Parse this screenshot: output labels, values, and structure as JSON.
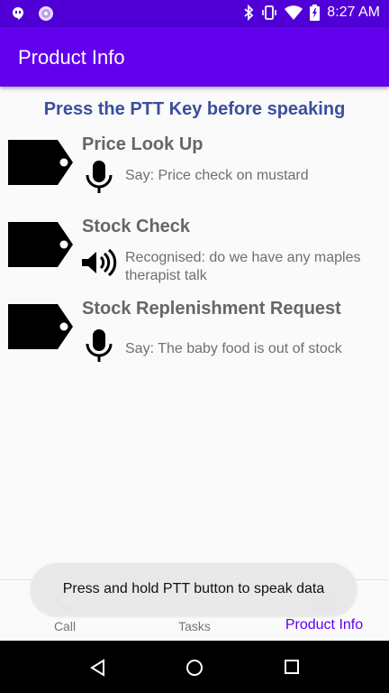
{
  "status_bar": {
    "time": "8:27 AM",
    "icons": [
      "hangouts-icon",
      "app-notification-icon",
      "bluetooth-icon",
      "vibrate-icon",
      "wifi-icon",
      "battery-charging-icon"
    ]
  },
  "app_bar": {
    "title": "Product Info"
  },
  "instruction": "Press the PTT Key before speaking",
  "items": [
    {
      "title": "Price Look Up",
      "icon": "microphone-icon",
      "detail": "Say: Price check on mustard"
    },
    {
      "title": "Stock Check",
      "icon": "speaker-icon",
      "detail": "Recognised: do we have any maples therapist talk"
    },
    {
      "title": "Stock Replenishment Request",
      "icon": "microphone-icon",
      "detail": "Say: The baby food is out of stock"
    }
  ],
  "bottom_nav": [
    {
      "label": "Call",
      "icon": "phone-icon",
      "active": false
    },
    {
      "label": "Tasks",
      "icon": "tasks-icon",
      "active": false
    },
    {
      "label": "Product Info",
      "icon": "product-icon",
      "active": true
    }
  ],
  "toast": "Press and hold PTT button to speak data",
  "colors": {
    "primary": "#6200ee",
    "status_bar": "#5000d6",
    "instruction": "#3a4f9c"
  }
}
